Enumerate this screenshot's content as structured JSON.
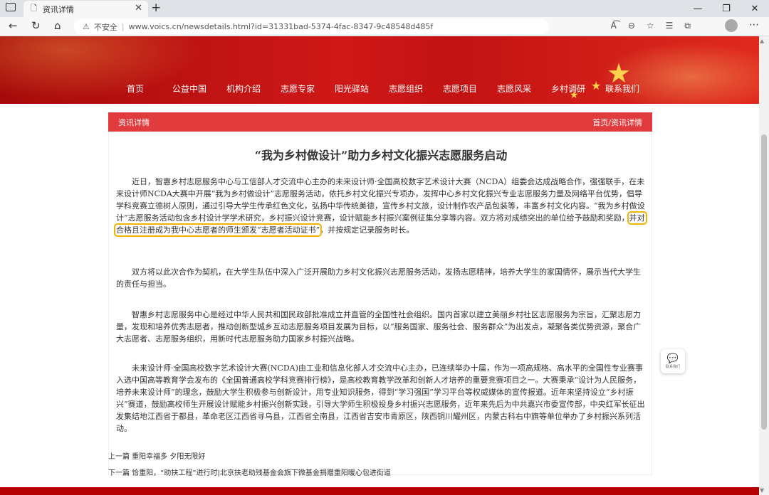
{
  "browser": {
    "tab_title": "资讯详情",
    "new_tab": "+",
    "security": "不安全",
    "url": "www.voics.cn/newsdetails.html?id=31331bad-5374-4fac-8347-9c48548d485f"
  },
  "nav": {
    "items": [
      "首页",
      "公益中国",
      "机构介绍",
      "志愿专家",
      "阳光驿站",
      "志愿组织",
      "志愿项目",
      "志愿风采",
      "乡村调研",
      "联系我们"
    ]
  },
  "section": {
    "title": "资讯详情",
    "breadcrumb": "首页/资讯详情"
  },
  "article": {
    "title": "“我为乡村做设计”助力乡村文化振兴志愿服务启动",
    "p1_a": "近日，智惠乡村志愿服务中心与工信部人才交流中心主办的未来设计师·全国高校数字艺术设计大赛（NCDA）组委会达成战略合作，强强联手，在未来设计师NCDA大赛中开展“我为乡村做设计”志愿服务活动，依托乡村文化振兴专项办，发挥中心乡村文化振兴专业志愿服务力量及网络平台优势，倡导学科竞赛立德树人原则，通过引导大学生传承红色文化，弘扬中华传统美德，宣传乡村文旅，设计制作农产品包装等，丰富乡村文化内容。“我为乡村做设计”志愿服务活动包含乡村设计学学术研究，乡村振兴设计竞赛，设计赋能乡村振兴案例征集分享等内容。双方将对成绩突出的单位给予鼓励和奖励，",
    "p1_highlight": "并对合格且注册成为我中心志愿者的师生颁发“志愿者活动证书”",
    "p1_b": "，并按规定记录服务时长。",
    "p2": "双方将以此次合作为契机，在大学生队伍中深入广泛开展助力乡村文化振兴志愿服务活动，发扬志愿精神，培养大学生的家国情怀，展示当代大学生的责任与担当。",
    "p3": "智惠乡村志愿服务中心是经过中华人民共和国民政部批准成立并直管的全国性社会组织。国内首家以建立美丽乡村社区志愿服务为宗旨，汇聚志愿力量，发现和培养优秀志愿者，推动创新型城乡互动志愿服务项目发展为目标，以“服务国家、服务社会、服务群众”为出发点，凝聚各类优势资源，聚合广大志愿者、志愿服务组织，用新时代志愿服务助力国家乡村振兴战略。",
    "p4": "未来设计师·全国高校数字艺术设计大赛(NCDA)由工业和信息化部人才交流中心主办，已连续举办十届，作为一项高规格、高水平的全国性专业赛事入选中国高等教育学会发布的《全国普通高校学科竞赛排行榜》，是高校教育教学改革和创新人才培养的重要竞赛项目之一。大赛秉承“设计为人民服务，培养未来设计师”的理念，鼓励大学生积极参与创新设计，用专业知识服务，得到“学习强国”学习平台等权威媒体的宣传报道。近年来坚持设立“乡村振兴”赛道，鼓励高校师生开展设计赋能乡村振兴创新实践，引导大学师生积极投身乡村振兴志愿服务，近年来先后为中共嘉兴市委宣传部，中央红军长征出发集结地江西省于都县，革命老区江西省寻乌县，江西省全南县，江西省吉安市青原区，陕西铜川耀州区，内蒙古科右中旗等单位举办了乡村振兴系列活动。"
  },
  "prev": "上一篇 重阳幸福多 夕阳无限好",
  "next": "下一篇 恰重阳，“助扶工程”进行时|北京扶老助残基金会旗下微基金捐赠重阳暖心包进街道",
  "feedback": "联系我们"
}
